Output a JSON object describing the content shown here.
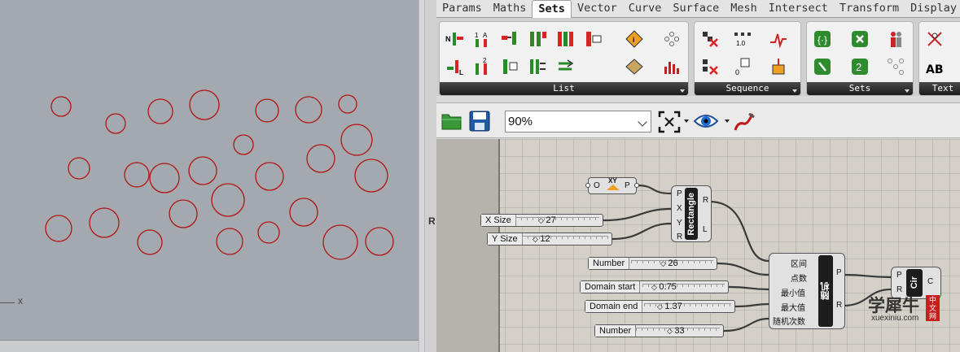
{
  "ribbon_tabs": [
    "Params",
    "Maths",
    "Sets",
    "Vector",
    "Curve",
    "Surface",
    "Mesh",
    "Intersect",
    "Transform",
    "Display"
  ],
  "active_tab": "Sets",
  "ribbon_panels": [
    {
      "label": "List"
    },
    {
      "label": "Sequence"
    },
    {
      "label": "Sets"
    },
    {
      "label": "Text"
    }
  ],
  "toolbar": {
    "zoom": "90%"
  },
  "viewport": {
    "axis_label": "x",
    "curve_color": "#b01515"
  },
  "canvas": {
    "edge_tab": "R",
    "point_param": {
      "left": "O",
      "right": "P",
      "badge": "XY"
    },
    "rectangle": {
      "name": "Rectangle",
      "inputs": [
        "P",
        "X",
        "Y",
        "R"
      ],
      "outputs": [
        "R",
        "L"
      ]
    },
    "sliders": [
      {
        "label": "X Size",
        "value": "27"
      },
      {
        "label": "Y Size",
        "value": "12"
      },
      {
        "label": "Number",
        "value": "26"
      },
      {
        "label": "Domain start",
        "value": "0.75"
      },
      {
        "label": "Domain end",
        "value": "1.37"
      },
      {
        "label": "Number",
        "value": "33"
      }
    ],
    "random": {
      "name": "随机",
      "inputs": [
        "区间",
        "点数",
        "最小值",
        "最大值",
        "随机次数"
      ],
      "outputs": [
        "P",
        "R"
      ]
    },
    "circle": {
      "name": "Cir",
      "inputs": [
        "P",
        "R"
      ],
      "outputs": [
        "C"
      ]
    }
  },
  "watermark": {
    "main": "学犀牛",
    "badge": "中文网",
    "url": "xuexiniu.com"
  },
  "colors": {
    "wire": "#3a3a3a",
    "viewport_bg": "#a4a9b0",
    "canvas_bg": "#d4d0c8"
  }
}
